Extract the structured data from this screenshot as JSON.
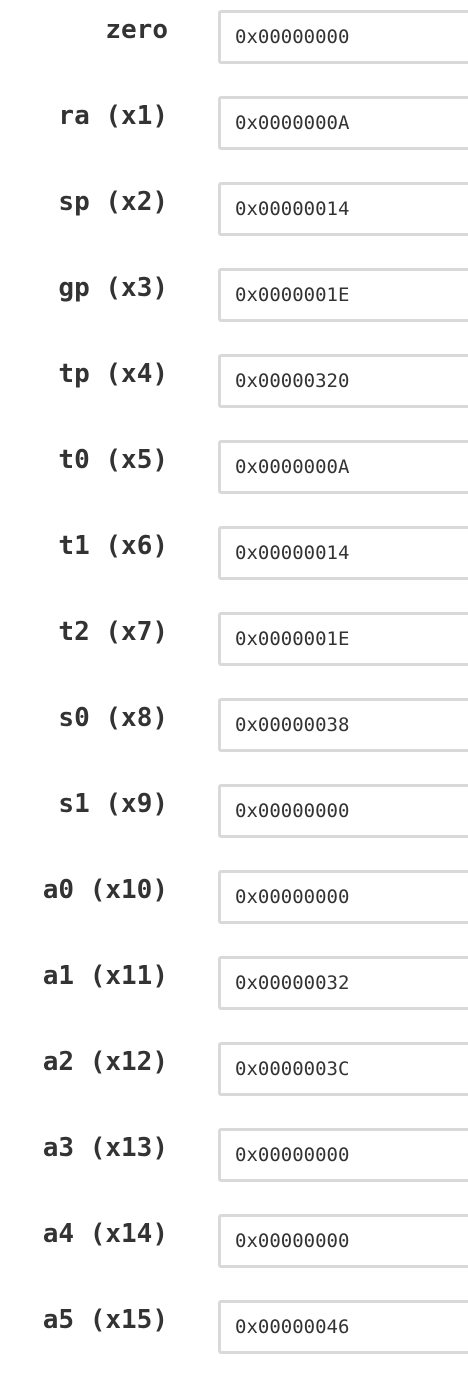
{
  "registers": [
    {
      "label": "zero",
      "value": "0x00000000"
    },
    {
      "label": "ra (x1)",
      "value": "0x0000000A"
    },
    {
      "label": "sp (x2)",
      "value": "0x00000014"
    },
    {
      "label": "gp (x3)",
      "value": "0x0000001E"
    },
    {
      "label": "tp (x4)",
      "value": "0x00000320"
    },
    {
      "label": "t0 (x5)",
      "value": "0x0000000A"
    },
    {
      "label": "t1 (x6)",
      "value": "0x00000014"
    },
    {
      "label": "t2 (x7)",
      "value": "0x0000001E"
    },
    {
      "label": "s0 (x8)",
      "value": "0x00000038"
    },
    {
      "label": "s1 (x9)",
      "value": "0x00000000"
    },
    {
      "label": "a0 (x10)",
      "value": "0x00000000"
    },
    {
      "label": "a1 (x11)",
      "value": "0x00000032"
    },
    {
      "label": "a2 (x12)",
      "value": "0x0000003C"
    },
    {
      "label": "a3 (x13)",
      "value": "0x00000000"
    },
    {
      "label": "a4 (x14)",
      "value": "0x00000000"
    },
    {
      "label": "a5 (x15)",
      "value": "0x00000046"
    }
  ]
}
